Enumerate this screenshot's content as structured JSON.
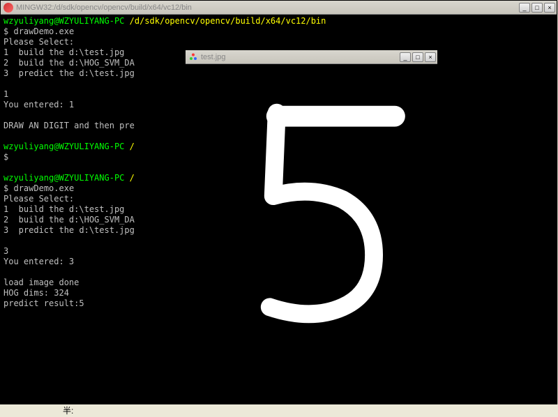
{
  "terminal_window": {
    "title": "MINGW32:/d/sdk/opencv/opencv/build/x64/vc12/bin",
    "buttons": {
      "min": "_",
      "max": "□",
      "close": "×"
    }
  },
  "image_window": {
    "title": "test.jpg",
    "buttons": {
      "min": "_",
      "max": "□",
      "close": "×"
    }
  },
  "prompt": {
    "user": "wzyuliyang@WZYULIYANG-PC",
    "path": "/d/sdk/opencv/opencv/build/x64/vc12/bin",
    "short_path": "/",
    "dollar": "$"
  },
  "terminal": {
    "cmd1": "drawDemo.exe",
    "select_header": "Please Select:",
    "opt1": "1  build the d:\\test.jpg",
    "opt2": "2  build the d:\\HOG_SVM_DA",
    "opt3": "3  predict the d:\\test.jpg",
    "input1": "1",
    "entered1": "You entered: 1",
    "draw_prompt": "DRAW AN DIGIT and then pre",
    "cmd2": "drawDemo.exe",
    "input2": "3",
    "entered2": "You entered: 3",
    "load_done": "load image done",
    "hog_dims": "HOG dims: 324",
    "predict": "predict result:5"
  },
  "status": {
    "label": "半:"
  }
}
